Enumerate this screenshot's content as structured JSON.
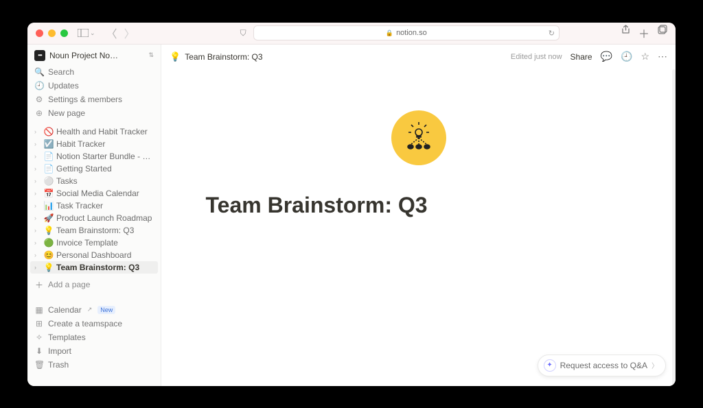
{
  "browser": {
    "url": "notion.so"
  },
  "workspace": {
    "name": "Noun Project No…"
  },
  "sidebar_top": {
    "search": "Search",
    "updates": "Updates",
    "settings": "Settings & members",
    "newpage": "New page"
  },
  "pages": [
    {
      "icon": "🚫",
      "label": "Health and Habit Tracker"
    },
    {
      "icon": "☑️",
      "label": "Habit Tracker"
    },
    {
      "icon": "",
      "label": "Notion Starter Bundle - …"
    },
    {
      "icon": "",
      "label": "Getting Started"
    },
    {
      "icon": "⚪",
      "label": "Tasks"
    },
    {
      "icon": "📅",
      "label": "Social Media Calendar"
    },
    {
      "icon": "📊",
      "label": "Task Tracker"
    },
    {
      "icon": "🚀",
      "label": "Product Launch Roadmap"
    },
    {
      "icon": "💡",
      "label": "Team Brainstorm: Q3"
    },
    {
      "icon": "🟢",
      "label": "Invoice Template"
    },
    {
      "icon": "😊",
      "label": "Personal Dashboard"
    },
    {
      "icon": "💡",
      "label": "Team Brainstorm: Q3",
      "active": true
    }
  ],
  "add_page": "Add a page",
  "bottom": {
    "calendar": "Calendar",
    "new_badge": "New",
    "teamspace": "Create a teamspace",
    "templates": "Templates",
    "import": "Import",
    "trash": "Trash"
  },
  "breadcrumb": {
    "icon": "💡",
    "title": "Team Brainstorm: Q3"
  },
  "topbar": {
    "edited": "Edited just now",
    "share": "Share"
  },
  "document": {
    "title": "Team Brainstorm: Q3"
  },
  "qa": {
    "label": "Request access to Q&A"
  }
}
